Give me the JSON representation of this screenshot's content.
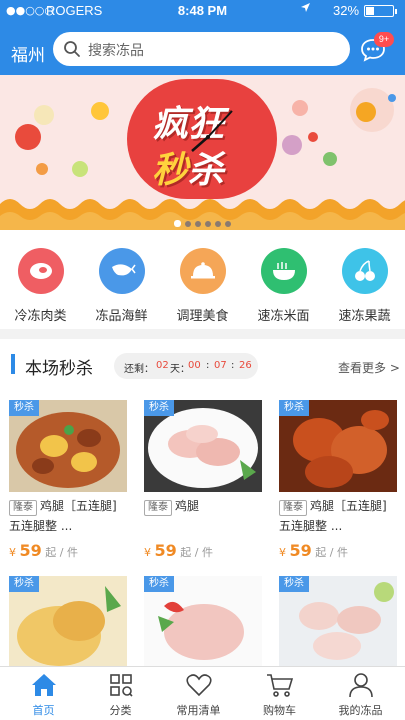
{
  "status_bar": {
    "signal": "●●○○○",
    "carrier": "ROGERS",
    "time": "8:48 PM",
    "battery": "32%",
    "battery_level": 0.32
  },
  "header": {
    "city": "福州",
    "search_placeholder": "搜索冻品",
    "message_badge": "9+"
  },
  "banner": {
    "title_line1": "疯狂",
    "title_line2a": "秒",
    "title_line2b": "杀",
    "slides": 6,
    "active_slide": 0
  },
  "categories": [
    {
      "label": "冷冻肉类",
      "color": "#ef5e63",
      "icon": "meat-icon"
    },
    {
      "label": "冻品海鲜",
      "color": "#4a98e8",
      "icon": "shrimp-icon"
    },
    {
      "label": "调理美食",
      "color": "#f5a657",
      "icon": "dish-cover-icon"
    },
    {
      "label": "速冻米面",
      "color": "#2fbf71",
      "icon": "noodle-bowl-icon"
    },
    {
      "label": "速冻果蔬",
      "color": "#3ec3e8",
      "icon": "cherry-icon"
    }
  ],
  "flash_sale": {
    "title": "本场秒杀",
    "timer_label": "还剩：",
    "days": "02",
    "days_unit": "天：",
    "hours": "00",
    "minutes": "07",
    "seconds": "26",
    "more": "查看更多 >",
    "tag": "秒杀",
    "items": [
      {
        "brand": "隆泰",
        "name": "鸡腿［五连腿]",
        "name2": "五连腿整 ...",
        "price": "59",
        "unit": "起 / 件"
      },
      {
        "brand": "隆泰",
        "name": "鸡腿",
        "name2": "",
        "price": "59",
        "unit": "起 / 件"
      },
      {
        "brand": "隆泰",
        "name": "鸡腿［五连腿]",
        "name2": "五连腿整 ...",
        "price": "59",
        "unit": "起 / 件"
      }
    ],
    "currency": "¥"
  },
  "tabs": [
    {
      "label": "首页",
      "icon": "home-icon"
    },
    {
      "label": "分类",
      "icon": "category-grid-icon"
    },
    {
      "label": "常用清单",
      "icon": "heart-icon"
    },
    {
      "label": "购物车",
      "icon": "cart-icon"
    },
    {
      "label": "我的冻品",
      "icon": "user-icon"
    }
  ],
  "colors": {
    "brand_blue": "#2d8ae6",
    "price_orange": "#f08a24",
    "timer_red": "#e84a3c",
    "banner_red": "#e8413f"
  }
}
